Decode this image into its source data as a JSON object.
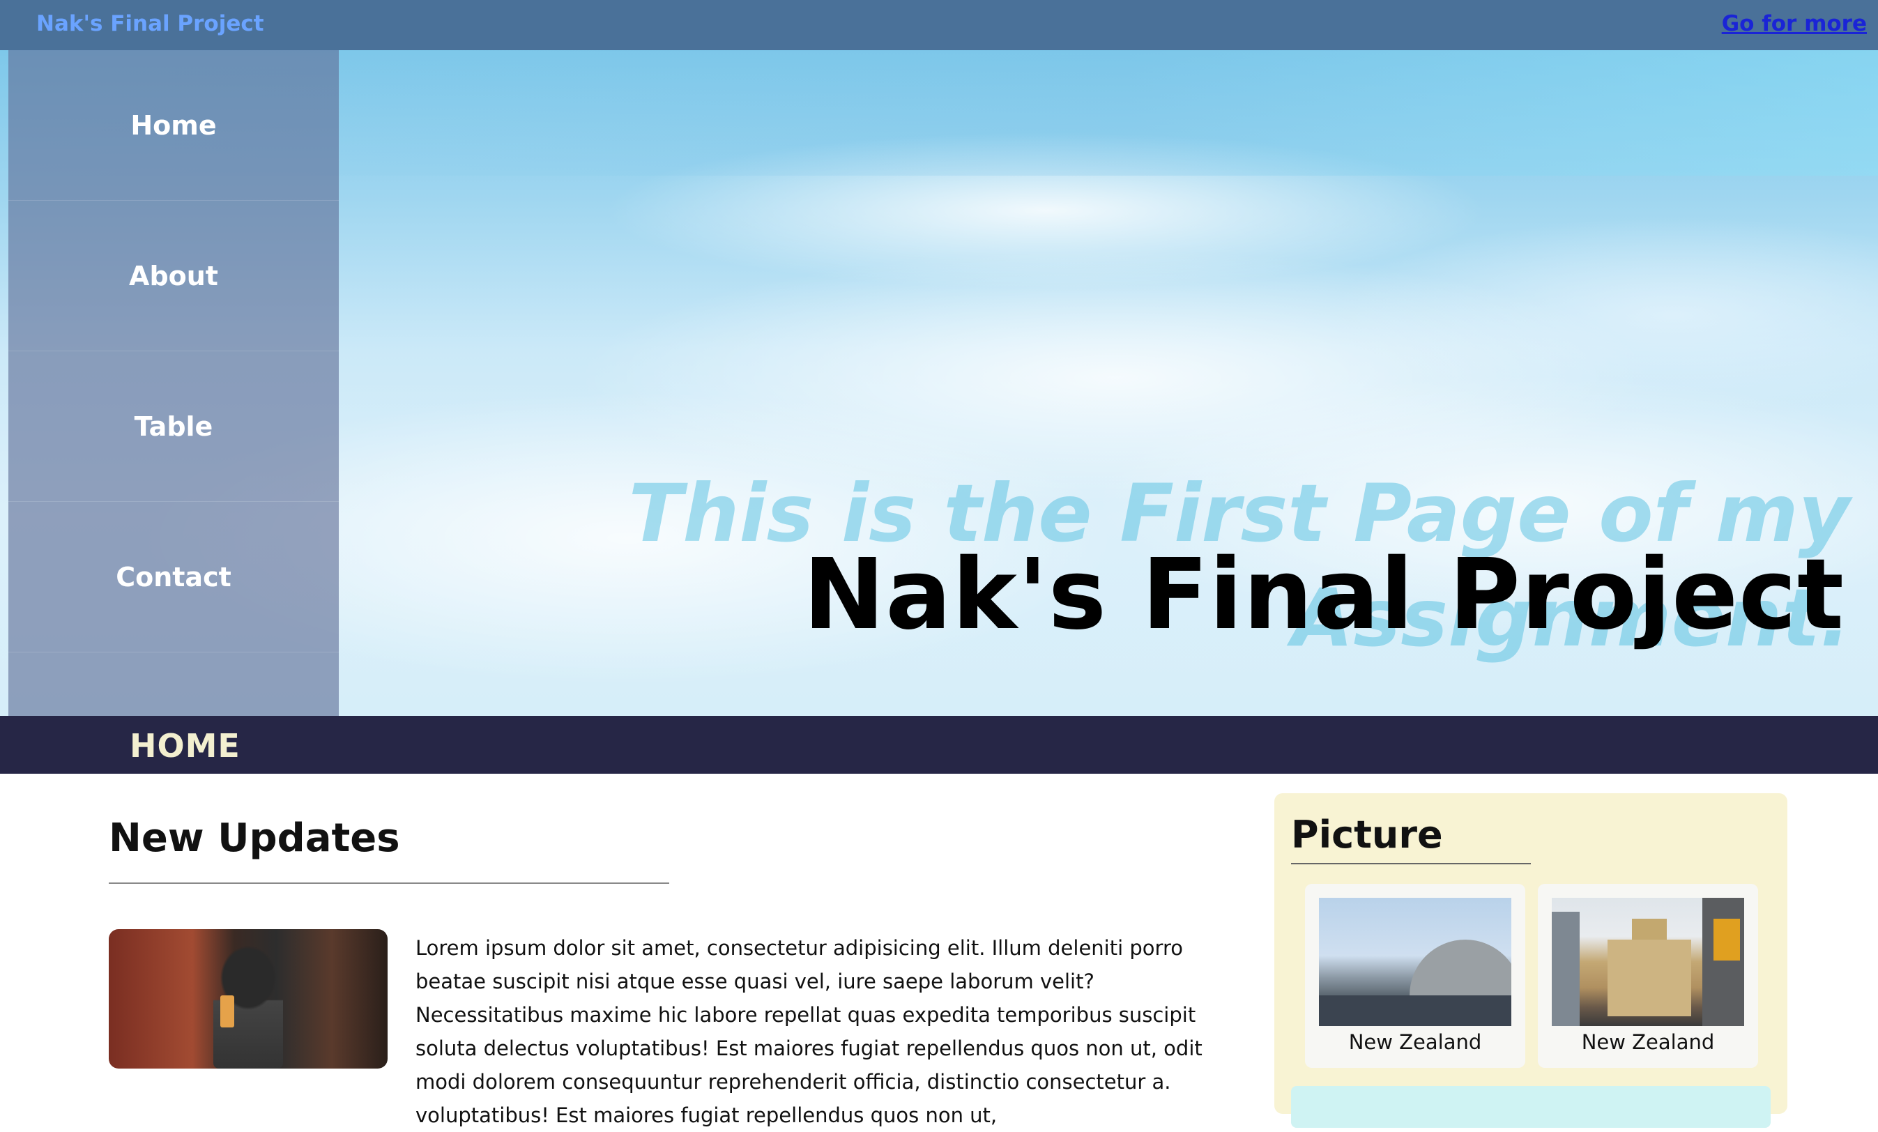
{
  "topbar": {
    "brand": "Nak's Final Project",
    "more_link": "Go for more"
  },
  "sidebar": {
    "items": [
      {
        "label": "Home"
      },
      {
        "label": "About"
      },
      {
        "label": "Table"
      },
      {
        "label": "Contact"
      }
    ]
  },
  "hero": {
    "background_text": "This is the First Page of my Assignment.",
    "title": "Nak's Final Project"
  },
  "section": {
    "title": "HOME"
  },
  "updates": {
    "heading": "New Updates",
    "body": "Lorem ipsum dolor sit amet, consectetur adipisicing elit. Illum deleniti porro beatae suscipit nisi atque esse quasi vel, iure saepe laborum velit? Necessitatibus maxime hic labore repellat quas expedita temporibus suscipit soluta delectus voluptatibus! Est maiores fugiat repellendus quos non ut, odit modi dolorem consequuntur reprehenderit officia, distinctio consectetur a. voluptatibus! Est maiores fugiat repellendus quos non ut,"
  },
  "pictures": {
    "heading": "Picture",
    "items": [
      {
        "caption": "New Zealand"
      },
      {
        "caption": "New Zealand"
      }
    ]
  },
  "colors": {
    "topbar": "#4a7199",
    "brand": "#6aa3ff",
    "link": "#1a24d6",
    "section_bar": "#262646",
    "section_title": "#f3efd0",
    "picture_panel": "#f8f3d3"
  }
}
